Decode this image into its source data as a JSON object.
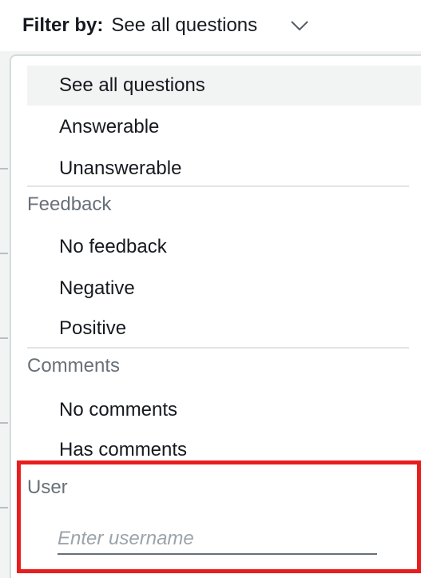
{
  "filter": {
    "label": "Filter by:",
    "selected_value": "See all questions"
  },
  "dropdown": {
    "options_top": [
      "See all questions",
      "Answerable",
      "Unanswerable"
    ],
    "feedback_header": "Feedback",
    "feedback_options": [
      "No feedback",
      "Negative",
      "Positive"
    ],
    "comments_header": "Comments",
    "comments_options": [
      "No comments",
      "Has comments"
    ],
    "user_header": "User",
    "username_placeholder": "Enter username"
  },
  "colors": {
    "highlight": "#e81e1e",
    "selected_bg": "#f2f3f3"
  },
  "icons": {
    "chevron": "chevron-down-icon"
  }
}
